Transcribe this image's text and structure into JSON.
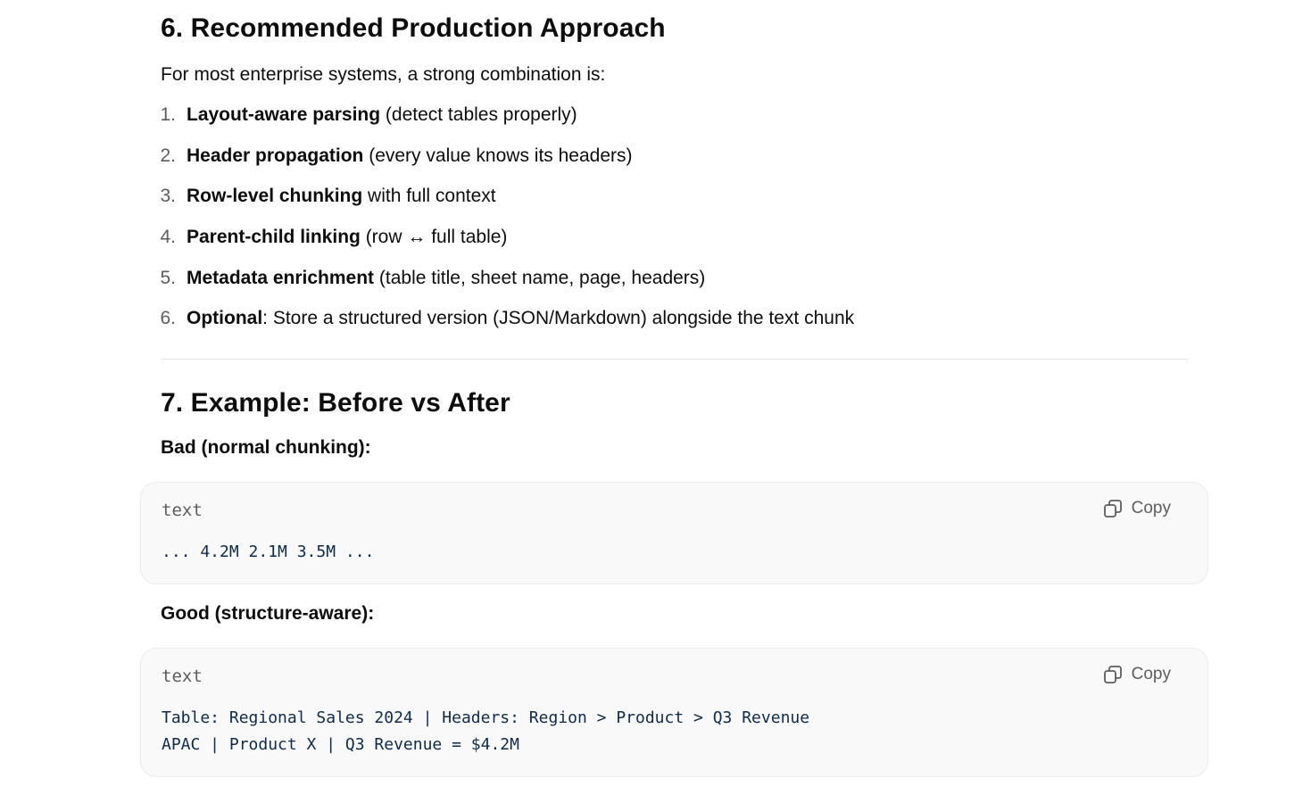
{
  "section6": {
    "heading": "6. Recommended Production Approach",
    "intro": "For most enterprise systems, a strong combination is:",
    "items": [
      {
        "num": "1.",
        "bold": "Layout-aware parsing",
        "rest": " (detect tables properly)"
      },
      {
        "num": "2.",
        "bold": "Header propagation",
        "rest": " (every value knows its headers)"
      },
      {
        "num": "3.",
        "bold": "Row-level chunking",
        "rest": " with full context"
      },
      {
        "num": "4.",
        "bold": "Parent-child linking",
        "rest": " (row ↔ full table)"
      },
      {
        "num": "5.",
        "bold": "Metadata enrichment",
        "rest": " (table title, sheet name, page, headers)"
      },
      {
        "num": "6.",
        "bold": "Optional",
        "rest": ": Store a structured version (JSON/Markdown) alongside the text chunk"
      }
    ]
  },
  "section7": {
    "heading": "7. Example: Before vs After",
    "bad_label": "Bad (normal chunking):",
    "good_label": "Good (structure-aware):",
    "code_blocks": [
      {
        "lang": "text",
        "copy_label": "Copy",
        "lines": [
          "... 4.2M 2.1M 3.5M ..."
        ]
      },
      {
        "lang": "text",
        "copy_label": "Copy",
        "lines": [
          "Table: Regional Sales 2024 | Headers: Region > Product > Q3 Revenue",
          "APAC | Product X | Q3 Revenue = $4.2M"
        ]
      }
    ]
  },
  "colors": {
    "text": "#0d0d0d",
    "muted": "#5d5d5d",
    "code_text": "#0f2a4a",
    "code_bg": "#f9f9f9"
  },
  "icons": {
    "copy": "copy-icon"
  }
}
